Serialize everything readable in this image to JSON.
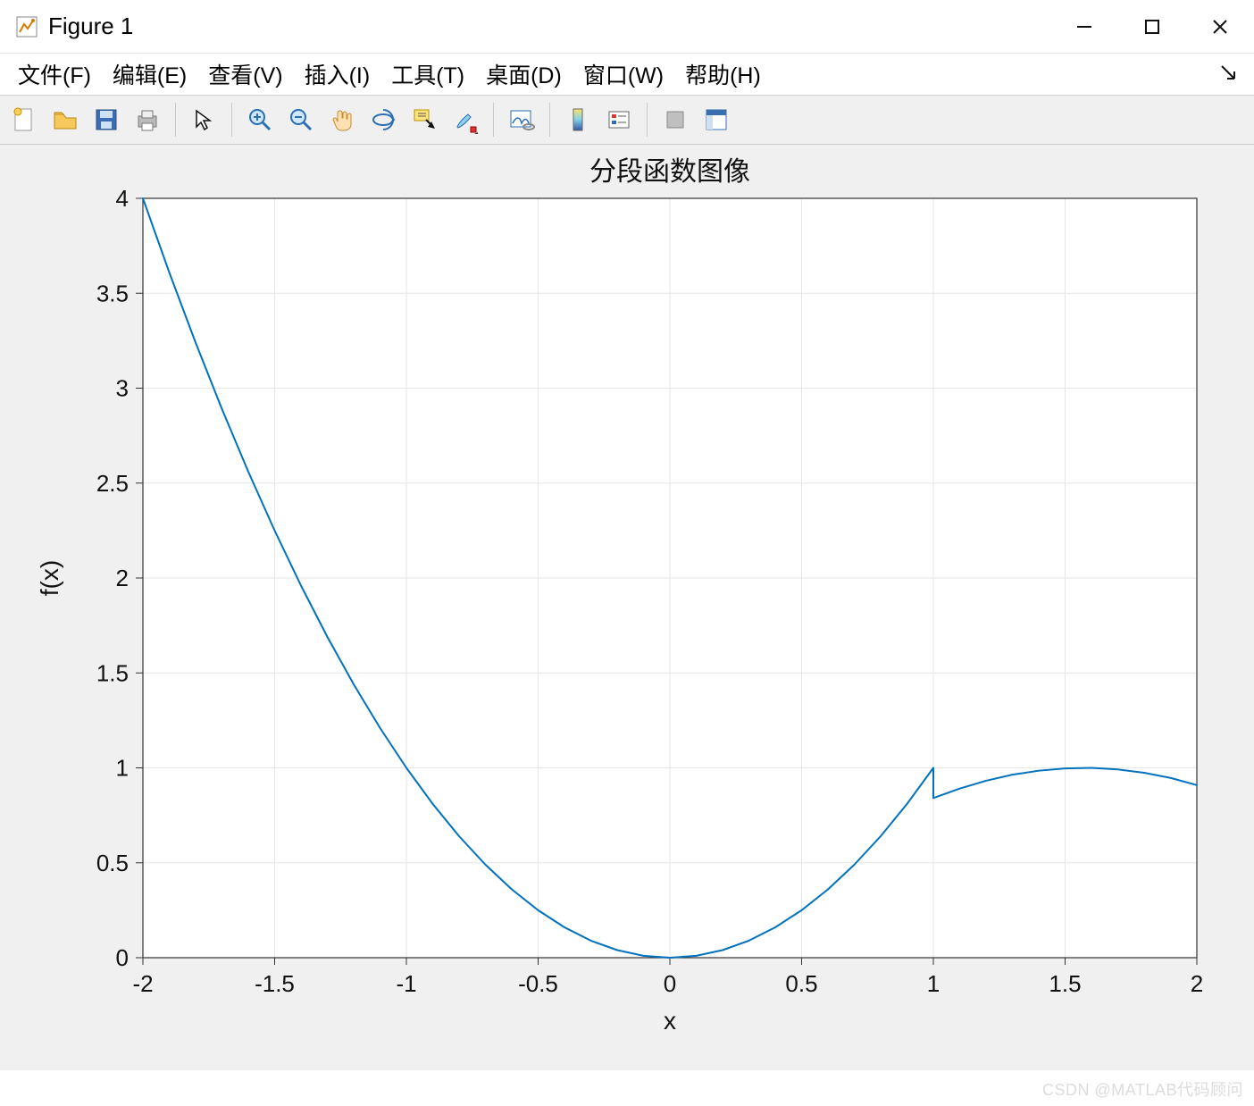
{
  "window": {
    "title": "Figure 1",
    "minimize_label": "Minimize",
    "maximize_label": "Maximize",
    "close_label": "Close"
  },
  "menu": {
    "file": "文件(F)",
    "edit": "编辑(E)",
    "view": "查看(V)",
    "insert": "插入(I)",
    "tools": "工具(T)",
    "desktop": "桌面(D)",
    "window": "窗口(W)",
    "help": "帮助(H)"
  },
  "toolbar_icons": {
    "new": "new-figure-icon",
    "open": "open-file-icon",
    "save": "save-icon",
    "print": "print-icon",
    "pointer": "pointer-icon",
    "zoom_in": "zoom-in-icon",
    "zoom_out": "zoom-out-icon",
    "pan": "pan-icon",
    "rotate3d": "rotate-3d-icon",
    "data_cursor": "data-cursor-icon",
    "brush": "brush-icon",
    "link": "link-plots-icon",
    "colorbar": "colorbar-icon",
    "legend": "legend-icon",
    "hide_tools": "hide-tools-icon",
    "dock": "dock-figure-icon"
  },
  "watermark": "CSDN @MATLAB代码顾问",
  "chart_data": {
    "type": "line",
    "title": "分段函数图像",
    "xlabel": "x",
    "ylabel": "f(x)",
    "xlim": [
      -2,
      2
    ],
    "ylim": [
      0,
      4
    ],
    "xticks": [
      -2,
      -1.5,
      -1,
      -0.5,
      0,
      0.5,
      1,
      1.5,
      2
    ],
    "yticks": [
      0,
      0.5,
      1,
      1.5,
      2,
      2.5,
      3,
      3.5,
      4
    ],
    "grid": true,
    "line_color": "#0072BD",
    "series": [
      {
        "name": "f(x)",
        "segments": [
          {
            "piece": "x^2  (x < 1)",
            "x": [
              -2.0,
              -1.9,
              -1.8,
              -1.7,
              -1.6,
              -1.5,
              -1.4,
              -1.3,
              -1.2,
              -1.1,
              -1.0,
              -0.9,
              -0.8,
              -0.7,
              -0.6,
              -0.5,
              -0.4,
              -0.3,
              -0.2,
              -0.1,
              0.0,
              0.1,
              0.2,
              0.3,
              0.4,
              0.5,
              0.6,
              0.7,
              0.8,
              0.9,
              1.0
            ],
            "y": [
              4.0,
              3.61,
              3.24,
              2.89,
              2.56,
              2.25,
              1.96,
              1.69,
              1.44,
              1.21,
              1.0,
              0.81,
              0.64,
              0.49,
              0.36,
              0.25,
              0.16,
              0.09,
              0.04,
              0.01,
              0.0,
              0.01,
              0.04,
              0.09,
              0.16,
              0.25,
              0.36,
              0.49,
              0.64,
              0.81,
              1.0
            ]
          },
          {
            "piece": "sin(x)  (x >= 1)",
            "x": [
              1.0,
              1.1,
              1.2,
              1.3,
              1.4,
              1.5,
              1.6,
              1.7,
              1.8,
              1.9,
              2.0
            ],
            "y": [
              0.841,
              0.891,
              0.932,
              0.964,
              0.985,
              0.997,
              1.0,
              0.992,
              0.974,
              0.947,
              0.909
            ]
          }
        ]
      }
    ]
  }
}
